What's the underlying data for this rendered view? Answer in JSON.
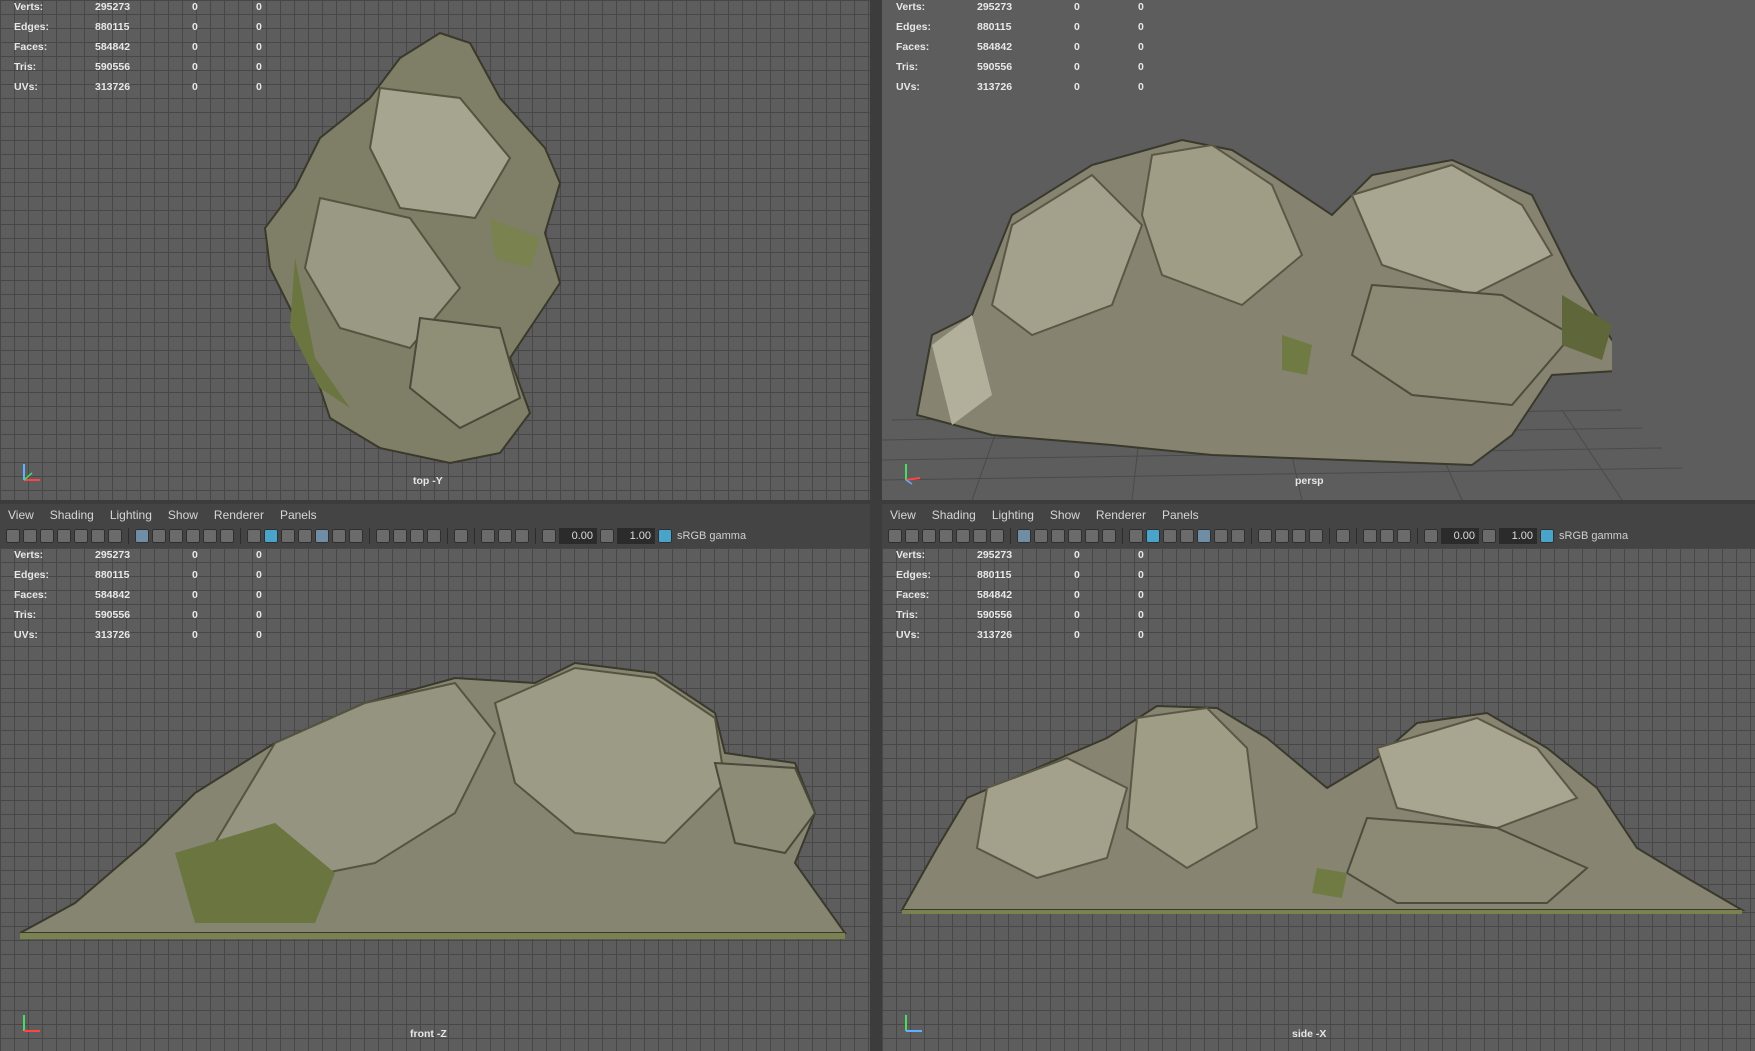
{
  "hud": {
    "rows": [
      {
        "key": "Verts:",
        "value": "295273",
        "z1": "0",
        "z2": "0"
      },
      {
        "key": "Edges:",
        "value": "880115",
        "z1": "0",
        "z2": "0"
      },
      {
        "key": "Faces:",
        "value": "584842",
        "z1": "0",
        "z2": "0"
      },
      {
        "key": "Tris:",
        "value": "590556",
        "z1": "0",
        "z2": "0"
      },
      {
        "key": "UVs:",
        "value": "313726",
        "z1": "0",
        "z2": "0"
      }
    ]
  },
  "viewports": {
    "top": {
      "label": "top -Y"
    },
    "persp": {
      "label": "persp"
    },
    "front": {
      "label": "front -Z"
    },
    "side": {
      "label": "side -X"
    }
  },
  "menu": {
    "view": "View",
    "shading": "Shading",
    "lighting": "Lighting",
    "show": "Show",
    "renderer": "Renderer",
    "panels": "Panels"
  },
  "toolbar": {
    "exposure": "0.00",
    "gamma": "1.00",
    "color_space": "sRGB gamma"
  },
  "colors": {
    "viewport_bg": "#5d5d5d",
    "grid_line": "#474747",
    "rock_main": "#8a8872",
    "rock_dark": "#5f5d4c",
    "moss": "#6e7a45",
    "accent_blue": "#4aa3c8"
  },
  "icons": [
    "camera-icon",
    "grid-icon",
    "wireframe-icon",
    "shaded-icon",
    "textured-icon",
    "lights-icon",
    "exposure-icon",
    "gamma-icon",
    "color-management-icon"
  ]
}
